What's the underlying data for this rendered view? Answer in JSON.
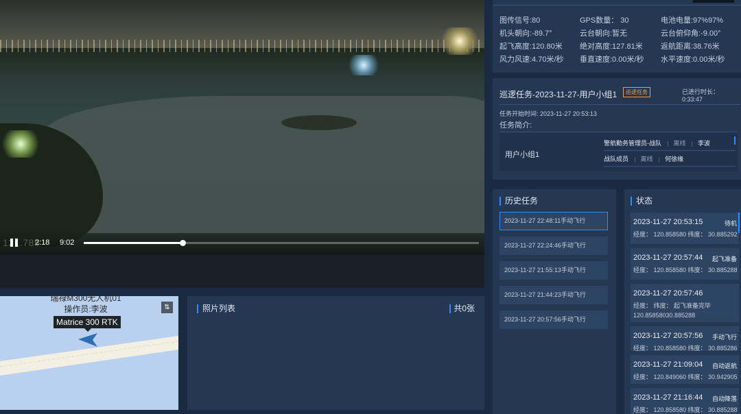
{
  "video": {
    "current_time": "2:18",
    "duration": "9:02",
    "progress_fraction": 0.25,
    "overlay_ghost_text": "121.785"
  },
  "map": {
    "uav_title": "瑞禄M300无人机01",
    "operator": "操作员:李波",
    "model": "Matrice 300 RTK"
  },
  "photos": {
    "title": "照片列表",
    "count": "共0张"
  },
  "telemetry": [
    [
      "图传信号:80",
      "GPS数量： 30",
      "电池电量:97%97%"
    ],
    [
      "机头朝向:-89.7°",
      "云台朝向:暂无",
      "云台俯仰角:-9.00°"
    ],
    [
      "起飞高度:120.80米",
      "绝对高度:127.81米",
      "返航距离:38.76米"
    ],
    [
      "风力风速:4.70米/秒",
      "垂直速度:0.00米/秒",
      "水平速度:0.00米/秒"
    ]
  ],
  "mission": {
    "title": "巡逻任务-2023-11-27-用户小组1",
    "tag": "巡逻任务",
    "elapsed": "已进行时长： 0:33:47",
    "start_time": "任务开始时间: 2023-11-27 20:53:13",
    "brief_label": "任务简介:",
    "group_name": "用户小组1",
    "members": [
      {
        "role": "警航勤务管理员-战队",
        "status": "离线",
        "name": "李波"
      },
      {
        "role": "战队成员",
        "status": "离线",
        "name": "何徐缘"
      }
    ]
  },
  "history": {
    "title": "历史任务",
    "items": [
      "2023-11-27 22:48:11手动飞行",
      "2023-11-27 22:24:46手动飞行",
      "2023-11-27 21:55:13手动飞行",
      "2023-11-27 21:44:23手动飞行",
      "2023-11-27 20:57:56手动飞行"
    ]
  },
  "status": {
    "title": "状态",
    "items": [
      {
        "time": "2023-11-27 20:53:15",
        "state": "待机",
        "lines": [
          "经度： 120.858580 纬度： 30.885292"
        ]
      },
      {
        "time": "2023-11-27 20:57:44",
        "state": "起飞准备",
        "lines": [
          "经度： 120.858580 纬度： 30.885288"
        ]
      },
      {
        "time": "2023-11-27 20:57:46",
        "state": "",
        "lines": [
          "经度：      纬度：       起飞准备完毕",
          "120.85858030.885288"
        ]
      },
      {
        "time": "2023-11-27 20:57:56",
        "state": "手动飞行",
        "lines": [
          "经度： 120.858580 纬度： 30.885286"
        ]
      },
      {
        "time": "2023-11-27 21:09:04",
        "state": "自动返航",
        "lines": [
          "经度： 120.849060 纬度： 30.942905"
        ]
      },
      {
        "time": "2023-11-27 21:16:44",
        "state": "自动降落",
        "lines": [
          "经度： 120.858580 纬度： 30.885288"
        ]
      }
    ]
  },
  "colors": {
    "panel": "#243753",
    "background": "#1a2a40",
    "accent": "#2f8bff",
    "tag": "#ff9a3c"
  }
}
